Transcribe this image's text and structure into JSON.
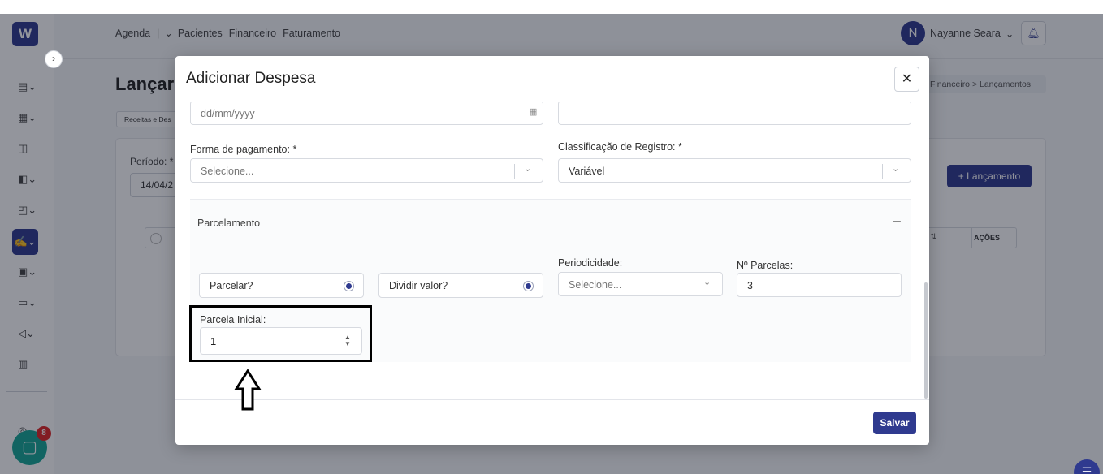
{
  "app": {
    "logo_text": "W",
    "topnav": [
      "Agenda",
      "Pacientes",
      "Financeiro",
      "Faturamento"
    ],
    "user_initial": "N",
    "user_name": "Nayanne Seara",
    "page_title": "Lançar",
    "breadcrumb": "Financeiro  >  Lançamentos",
    "tab_label": "Receitas e Des",
    "periodo_label": "Período: *",
    "periodo_value": "14/04/2",
    "add_button": "+ Lançamento",
    "table_actions_header": "AÇÕES",
    "chat_badge": "8"
  },
  "modal": {
    "title": "Adicionar Despesa",
    "date_placeholder": "dd/mm/yyyy",
    "forma_pagamento_label": "Forma de pagamento: *",
    "forma_pagamento_value": "Selecione...",
    "classificacao_label": "Classificação de Registro: *",
    "classificacao_value": "Variável",
    "parcelamento_title": "Parcelamento",
    "parcelamento_toggle": "–",
    "parcelar_label": "Parcelar?",
    "dividir_label": "Dividir valor?",
    "periodicidade_label": "Periodicidade:",
    "periodicidade_value": "Selecione...",
    "num_parcelas_label": "Nº Parcelas:",
    "num_parcelas_value": "3",
    "parcela_inicial_label": "Parcela Inicial:",
    "parcela_inicial_value": "1",
    "save_button": "Salvar"
  },
  "colors": {
    "brand": "#2f3a8f",
    "chat": "#14a795",
    "badge": "#e02424"
  }
}
